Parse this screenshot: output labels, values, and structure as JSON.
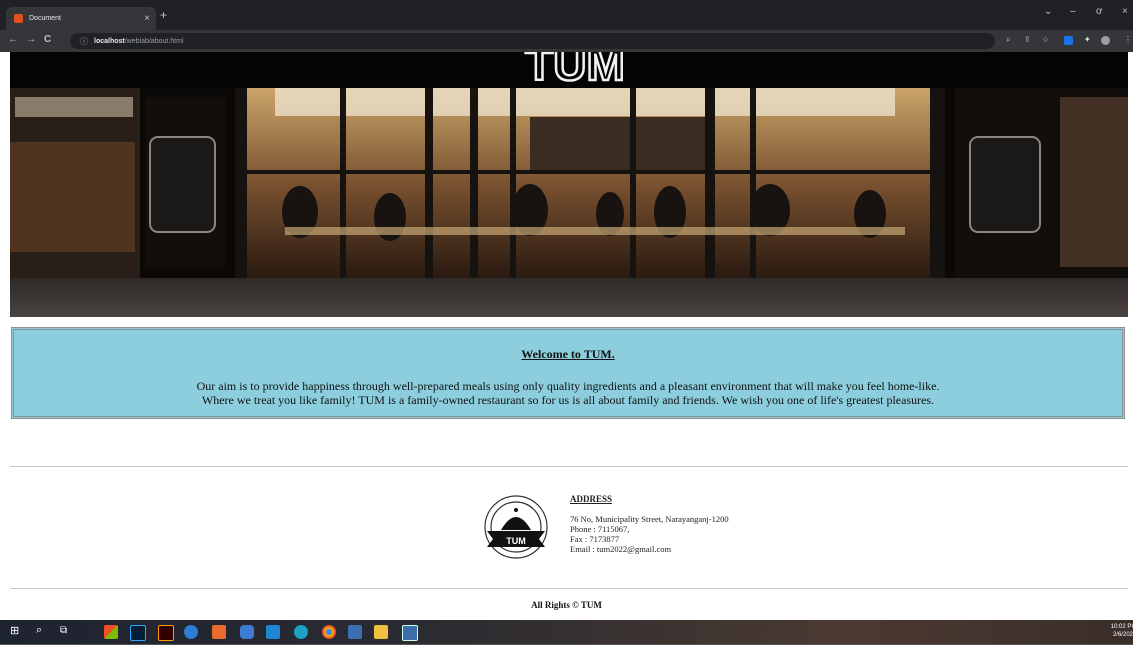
{
  "browser": {
    "tab_title": "Document",
    "tab_close": "×",
    "new_tab": "+",
    "url_host": "localhost",
    "url_path": "/weblab/about.html",
    "nav": {
      "back": "←",
      "forward": "→",
      "reload": "C",
      "info": "ⓘ"
    },
    "window_controls": {
      "chevron": "⌄",
      "minimize": "–",
      "restore": "ơ",
      "close": "×"
    }
  },
  "hero": {
    "brand_text": "TUM"
  },
  "welcome": {
    "heading": "Welcome to TUM.",
    "line1": "Our aim is to provide happiness through well-prepared meals using only quality ingredients and a pleasant environment that will make you feel home-like.",
    "line2": "Where we treat you like family! TUM is a family-owned restaurant so for us is all about family and friends. We wish you one of life's greatest pleasures."
  },
  "footer": {
    "logo_text": "TUM",
    "address_heading": "ADDRESS",
    "street": "76 No, Municipality Street, Narayanganj-1200",
    "phone": "Phone : 7115067,",
    "fax": "Fax : 7173877",
    "email": "Email : tum2022@gmail.com",
    "copyright": "All Rights © TUM"
  },
  "taskbar": {
    "time": "10:02 PI",
    "date": "2/6/202"
  },
  "colors": {
    "welcome_bg": "#8ccedd",
    "chrome_dark": "#202124",
    "chrome_mid": "#35363a"
  }
}
